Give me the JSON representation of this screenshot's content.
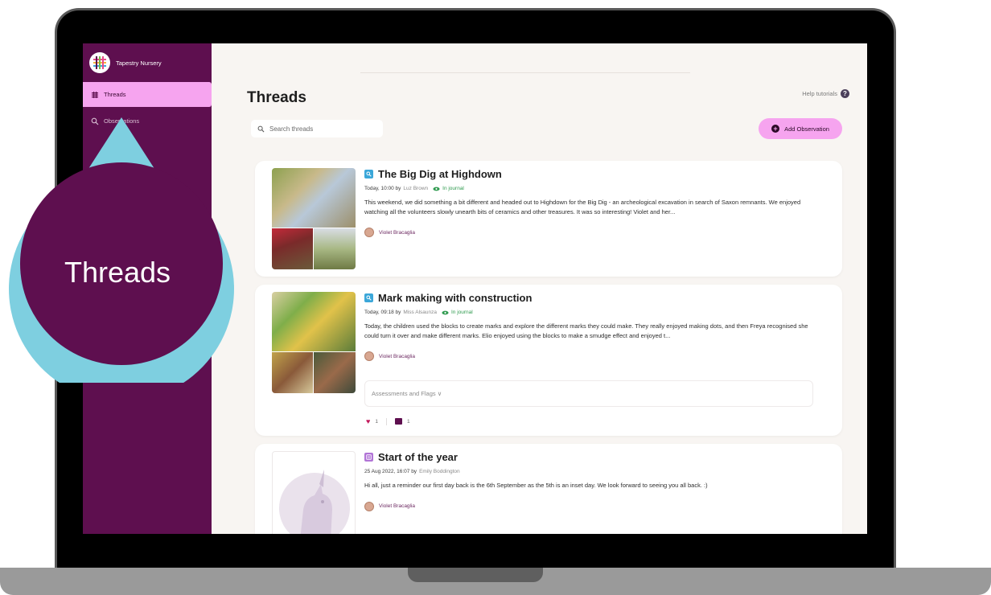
{
  "app": {
    "brand_name": "Tapestry Nursery"
  },
  "sidebar": {
    "items": [
      {
        "label": "Threads",
        "icon": "threads-icon",
        "active": true
      },
      {
        "label": "Observations",
        "icon": "search-icon",
        "active": false
      }
    ]
  },
  "header": {
    "title": "Threads",
    "help_label": "Help tutorials",
    "help_icon_glyph": "?",
    "search_placeholder": "Search threads",
    "add_button_label": "Add Observation",
    "add_button_icon_glyph": "+"
  },
  "callout": {
    "label": "Threads",
    "colors": {
      "ring": "#7ecfe0",
      "fill": "#5e0f4f"
    }
  },
  "posts": [
    {
      "type": "observation",
      "title": "The Big Dig at Highdown",
      "date": "Today, 10:00 by",
      "author": "Luz Brown",
      "status": "In journal",
      "text": "This weekend, we did something a bit different and headed out to Highdown for the Big Dig - an archeological excavation in search of Saxon remnants. We enjoyed watching all the volunteers slowly unearth bits of ceramics and other treasures. It was so interesting! Violet and her...",
      "child": "Violet Bracaglia"
    },
    {
      "type": "observation",
      "title": "Mark making with construction",
      "date": "Today, 09:18 by",
      "author": "Miss Alsaunza",
      "status": "In journal",
      "text": "Today, the children used the blocks to create marks and explore the different marks they could make. They really enjoyed making dots, and then Freya recognised she could turn it over and make different marks. Elio enjoyed using the blocks to make a smudge effect and enjoyed t...",
      "child": "Violet Bracaglia",
      "assessments_label": "Assessments and Flags ∨",
      "likes": "1",
      "comments": "1"
    },
    {
      "type": "memo",
      "title": "Start of the year",
      "date": "25 Aug 2022, 16:07 by",
      "author": "Emily Boddington",
      "text": "Hi all, just a reminder our first day back is the 6th September as the 5th is an inset day. We look forward to seeing you all back. :)",
      "child": "Violet Bracaglia"
    }
  ],
  "colors": {
    "sidebar": "#5e0f4f",
    "accent_pink": "#f6a4ef",
    "journal_green": "#2f9a4f",
    "observation_blue": "#3ba7d9"
  }
}
